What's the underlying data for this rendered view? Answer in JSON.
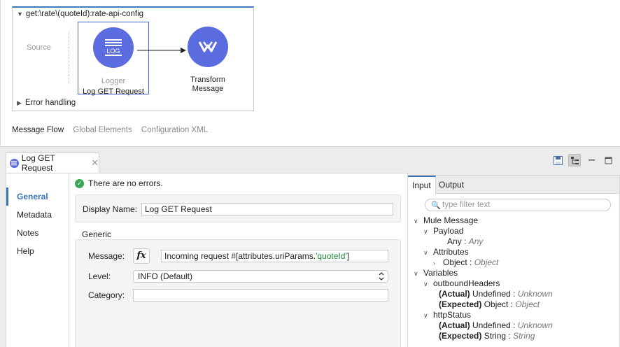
{
  "flow": {
    "title": "get:\\rate\\(quoteId):rate-api-config",
    "source_label": "Source",
    "logger": {
      "type": "Logger",
      "name": "Log GET Request",
      "icon_text": "LOG"
    },
    "transform": {
      "name_line1": "Transform",
      "name_line2": "Message"
    },
    "error_handling": "Error handling"
  },
  "canvas_tabs": [
    "Message Flow",
    "Global Elements",
    "Configuration XML"
  ],
  "editor_tab": {
    "label": "Log GET Request"
  },
  "sidenav": [
    "General",
    "Metadata",
    "Notes",
    "Help"
  ],
  "status": "There are no errors.",
  "form": {
    "display_name_label": "Display Name:",
    "display_name_value": "Log GET Request",
    "generic_label": "Generic",
    "message_label": "Message:",
    "fx_label": "fx",
    "message_prefix": "Incoming request #[attributes.uriParams.",
    "message_key": "'quoteId'",
    "message_suffix": "]",
    "level_label": "Level:",
    "level_value": "INFO (Default)",
    "category_label": "Category:",
    "category_value": ""
  },
  "metadata_pane": {
    "tabs": [
      "Input",
      "Output"
    ],
    "filter_placeholder": "type filter text",
    "tree": {
      "mule_message": "Mule Message",
      "payload": "Payload",
      "any_name": "Any",
      "any_type": "Any",
      "attributes": "Attributes",
      "object_name": "Object",
      "object_type": "Object",
      "variables": "Variables",
      "outbound_headers": "outboundHeaders",
      "oh_actual_label": "(Actual)",
      "oh_actual_value": "Undefined",
      "oh_actual_type": "Unknown",
      "oh_expected_label": "(Expected)",
      "oh_expected_value": "Object",
      "oh_expected_type": "Object",
      "http_status": "httpStatus",
      "hs_actual_label": "(Actual)",
      "hs_actual_value": "Undefined",
      "hs_actual_type": "Unknown",
      "hs_expected_label": "(Expected)",
      "hs_expected_value": "String",
      "hs_expected_type": "String"
    }
  },
  "colors": {
    "accent": "#3a73b6",
    "component": "#5b6ce0",
    "ok": "#3aa655"
  }
}
